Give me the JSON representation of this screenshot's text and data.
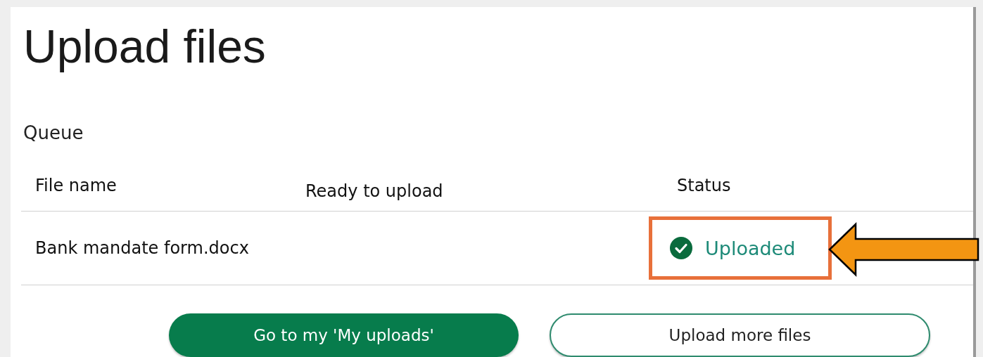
{
  "page": {
    "title": "Upload files",
    "section": "Queue"
  },
  "table": {
    "columns": [
      "File name",
      "Ready to upload",
      "Status"
    ],
    "rows": [
      {
        "file_name": "Bank mandate form.docx",
        "status": "Uploaded",
        "kind": "success",
        "highlighted": true
      }
    ]
  },
  "buttons": [
    {
      "label": "Go to my 'My uploads'",
      "kind": "primary"
    },
    {
      "label": "Upload more files",
      "kind": "secondary"
    }
  ]
}
